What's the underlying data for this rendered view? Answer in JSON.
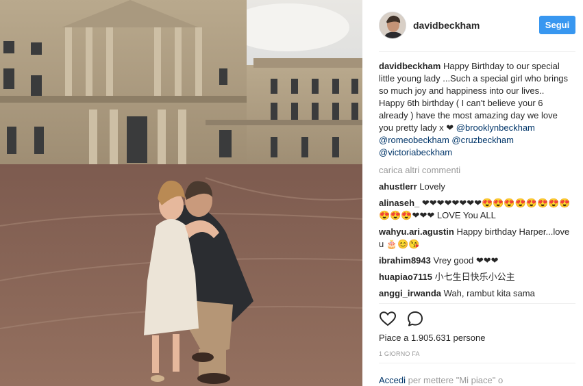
{
  "post": {
    "username": "davidbeckham",
    "follow_label": "Segui",
    "caption_text": "Happy Birthday to our special little young lady ...Such a special girl who brings so much joy and happiness into our lives.. Happy 6th birthday ( I can't believe your 6 already ) have the most amazing day we love you pretty lady x ❤",
    "mentions": [
      "@brooklynbeckham",
      "@romeobeckham",
      "@cruzbeckham",
      "@victoriabeckham"
    ],
    "load_more": "carica altri commenti",
    "comments": [
      {
        "user": "ahustlerr",
        "text": "Lovely"
      },
      {
        "user": "alinaseh_",
        "text": "❤❤❤❤❤❤❤❤😍😍😍😍😍😍😍😍😍😍😍❤❤❤ LOVE You ALL"
      },
      {
        "user": "wahyu.ari.agustin",
        "text": "Happy birthday Harper...love u 🎂😊😘"
      },
      {
        "user": "ibrahim8943",
        "text": "Vrey good ❤❤❤"
      },
      {
        "user": "huapiao7115",
        "text": "小七生日快乐小公主"
      },
      {
        "user": "anggi_irwanda",
        "text": "Wah, rambut kita sama"
      }
    ],
    "likes_prefix": "Piace a",
    "likes_count": "1.905.631",
    "likes_suffix": "persone",
    "date": "1 GIORNO FA",
    "login_link": "Accedi",
    "login_text": "per mettere \"Mi piace\" o"
  },
  "icons": {
    "like": "heart-icon",
    "comment": "comment-bubble-icon"
  },
  "colors": {
    "follow_button": "#3897f0",
    "mention": "#003569",
    "muted": "#999999"
  }
}
